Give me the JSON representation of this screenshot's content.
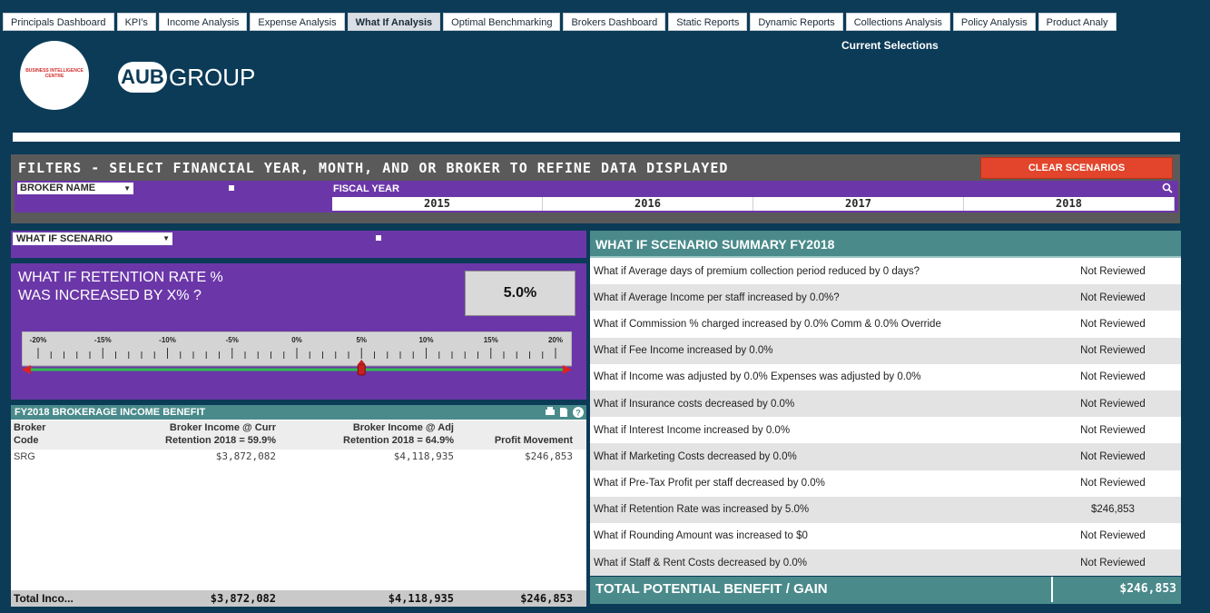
{
  "tabs": [
    {
      "label": "Principals Dashboard",
      "active": false
    },
    {
      "label": "KPI's",
      "active": false
    },
    {
      "label": "Income Analysis",
      "active": false
    },
    {
      "label": "Expense Analysis",
      "active": false
    },
    {
      "label": "What If Analysis",
      "active": true
    },
    {
      "label": "Optimal Benchmarking",
      "active": false
    },
    {
      "label": "Brokers Dashboard",
      "active": false
    },
    {
      "label": "Static Reports",
      "active": false
    },
    {
      "label": "Dynamic Reports",
      "active": false
    },
    {
      "label": "Collections Analysis",
      "active": false
    },
    {
      "label": "Policy Analysis",
      "active": false
    },
    {
      "label": "Product Analy",
      "active": false
    }
  ],
  "header": {
    "current_selections": "Current Selections",
    "bic_logo_text": "BUSINESS INTELLIGENCE CENTRE",
    "aub_mark": "AUB",
    "aub_group": "GROUP"
  },
  "filters": {
    "title": "FILTERS - SELECT FINANCIAL YEAR, MONTH, AND OR BROKER TO REFINE DATA DISPLAYED",
    "clear_label": "CLEAR SCENARIOS",
    "broker_dropdown": "BROKER NAME",
    "fiscal_label": "FISCAL YEAR",
    "years": [
      "2015",
      "2016",
      "2017",
      "2018"
    ]
  },
  "whatif": {
    "dropdown": "WHAT IF SCENARIO",
    "retention_title_1": "WHAT IF RETENTION RATE %",
    "retention_title_2": "WAS INCREASED BY X% ?",
    "retention_value": "5.0%",
    "slider": {
      "ticks": [
        "-20%",
        "-15%",
        "-10%",
        "-5%",
        "0%",
        "5%",
        "10%",
        "15%",
        "20%"
      ],
      "min": -20,
      "max": 20,
      "value": 5
    }
  },
  "brokerage": {
    "title": "FY2018 BROKERAGE INCOME BENEFIT",
    "col_code_1": "Broker",
    "col_code_2": "Code",
    "col_curr_1": "Broker Income @ Curr",
    "col_curr_2": "Retention 2018 = 59.9%",
    "col_adj_1": "Broker Income @ Adj",
    "col_adj_2": "Retention 2018 = 64.9%",
    "col_profit": "Profit Movement",
    "rows": [
      {
        "code": "SRG",
        "curr": "$3,872,082",
        "adj": "$4,118,935",
        "profit": "$246,853"
      }
    ],
    "total": {
      "label": "Total Inco...",
      "curr": "$3,872,082",
      "adj": "$4,118,935",
      "profit": "$246,853"
    }
  },
  "summary": {
    "title": "WHAT IF SCENARIO SUMMARY FY2018",
    "rows": [
      {
        "q": "What if Average days of premium collection period reduced by 0 days?",
        "v": "Not Reviewed"
      },
      {
        "q": "What if Average Income per staff increased by 0.0%?",
        "v": "Not Reviewed"
      },
      {
        "q": "What if Commission % charged increased by 0.0% Comm & 0.0% Override",
        "v": "Not Reviewed"
      },
      {
        "q": "What if Fee Income increased by 0.0%",
        "v": "Not Reviewed"
      },
      {
        "q": "What if Income was adjusted by 0.0% Expenses was adjusted by 0.0%",
        "v": "Not Reviewed"
      },
      {
        "q": "What if Insurance costs decreased by 0.0%",
        "v": "Not Reviewed"
      },
      {
        "q": "What if Interest Income increased by 0.0%",
        "v": "Not Reviewed"
      },
      {
        "q": "What if Marketing Costs decreased by 0.0%",
        "v": "Not Reviewed"
      },
      {
        "q": "What if Pre-Tax Profit per staff decreased by 0.0%",
        "v": "Not Reviewed"
      },
      {
        "q": "What if Retention Rate was increased by 5.0%",
        "v": "$246,853"
      },
      {
        "q": "What if Rounding Amount was increased to $0",
        "v": "Not Reviewed"
      },
      {
        "q": "What if Staff & Rent Costs decreased by 0.0%",
        "v": "Not Reviewed"
      }
    ],
    "total_label": "TOTAL POTENTIAL BENEFIT / GAIN",
    "total_value": "$246,853"
  },
  "colors": {
    "background": "#0b3b57",
    "purple": "#6b37a8",
    "teal": "#4a8a8b",
    "clear_button": "#e2452b",
    "slider_track": "#2fbf4f",
    "slider_red": "#e02020"
  }
}
